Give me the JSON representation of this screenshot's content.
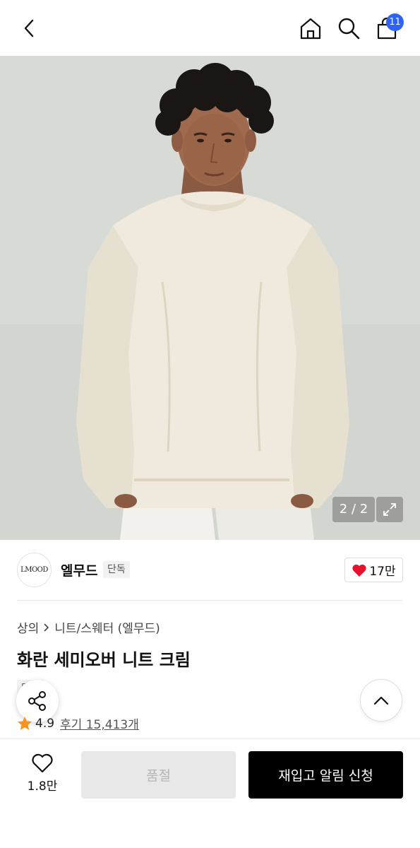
{
  "header": {
    "icons": [
      "back-arrow-icon",
      "home-icon",
      "search-icon",
      "shopping-bag-icon"
    ],
    "cart_badge": "11"
  },
  "gallery": {
    "counter": "2 / 2",
    "expand_icon": "expand-arrows-icon"
  },
  "brand": {
    "logo_text": "LMOOD",
    "name": "엘무드",
    "tag": "단독",
    "likes": "17만",
    "like_icon": "heart-filled-icon"
  },
  "product": {
    "breadcrumb": [
      "상의",
      "니트/스웨터 (엘무드)"
    ],
    "title": "화란 세미오버 니트 크림",
    "tag": "단독",
    "rating": "4.9",
    "reviews": "후기 15,413개"
  },
  "bottom_bar": {
    "wish_count": "1.8만",
    "soldout_label": "품절",
    "restock_label": "재입고 알림 신청"
  },
  "colors": {
    "badge": "#2f63f5",
    "heart": "#e8112d",
    "star": "#f7931e",
    "primary_button": "#000000",
    "disabled_button": "#e8e8e8"
  }
}
